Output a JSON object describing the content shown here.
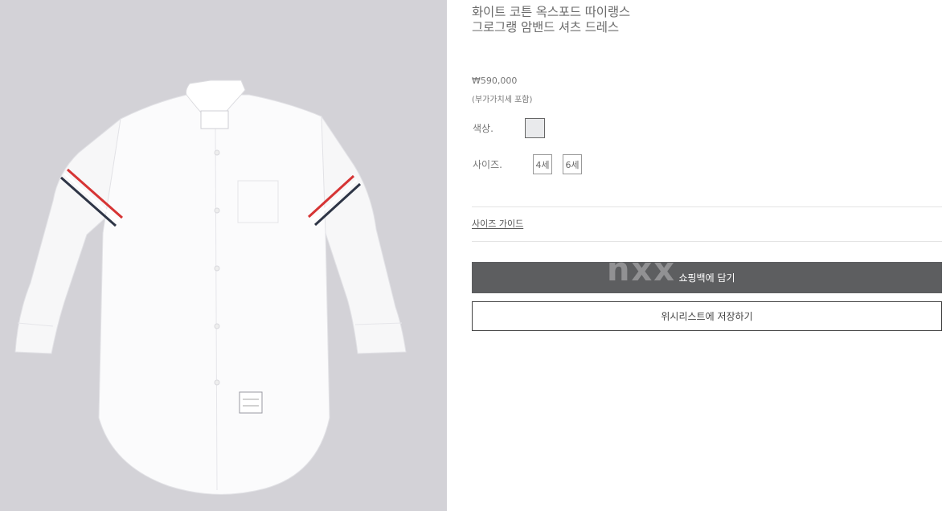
{
  "product": {
    "title": "화이트 코튼 옥스포드 따이랭스 그로그랭 암밴드 셔츠 드레스",
    "price": "₩590,000",
    "vat_note": "(부가가치세 포함)",
    "image_icon": "white-shirt-dress-photo",
    "shirt_label_text": "THOM BROWNE"
  },
  "options": {
    "color_label": "색상.",
    "color_swatch": "#e9eaec",
    "size_label": "사이즈.",
    "sizes": [
      "4세",
      "6세"
    ]
  },
  "links": {
    "size_guide": "사이즈 가이드"
  },
  "actions": {
    "cart_watermark": "nxx",
    "add_to_cart": "쇼핑백에 담기",
    "wishlist": "위시리스트에 저장하기"
  },
  "colors": {
    "image_background": "#d3d2d7",
    "cart_button": "#5d5e60",
    "stripe_red": "#d63434",
    "stripe_navy": "#2e3546"
  }
}
